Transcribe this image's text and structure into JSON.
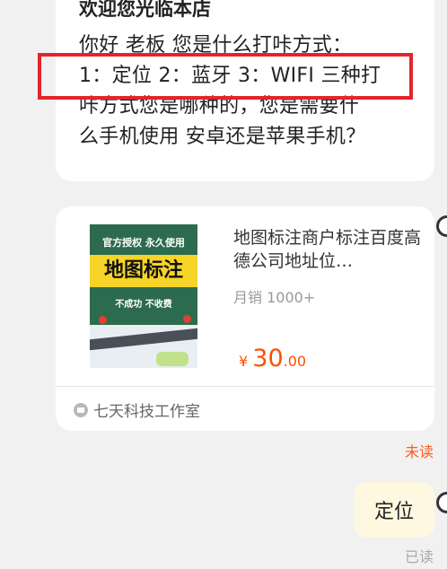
{
  "message": {
    "title": "欢迎您光临本店",
    "lines": [
      "你好 老板 您是什么打咔方式：",
      "1：定位 2：蓝牙 3：WIFI 三种打",
      "咔方式您是哪种的，您是需要什",
      "么手机使用 安卓还是苹果手机？"
    ]
  },
  "product": {
    "image": {
      "badge_text": "官方授权 永久使用",
      "headline": "地图标注",
      "subtext": "不成功 不收费"
    },
    "title": "地图标注商户标注百度高德公司地址位…",
    "sales": "月销 1000+",
    "currency": "¥",
    "price_int": "30",
    "price_dec": ".00",
    "shop_name": "七天科技工作室"
  },
  "status": {
    "unread": "未读",
    "read": "已读"
  },
  "reply": {
    "text": "定位"
  },
  "colors": {
    "highlight": "#e4242b",
    "price": "#ff4f00",
    "unread": "#ff5a1f",
    "reply_bubble": "#fff8e1",
    "background": "#f1f1f1"
  }
}
